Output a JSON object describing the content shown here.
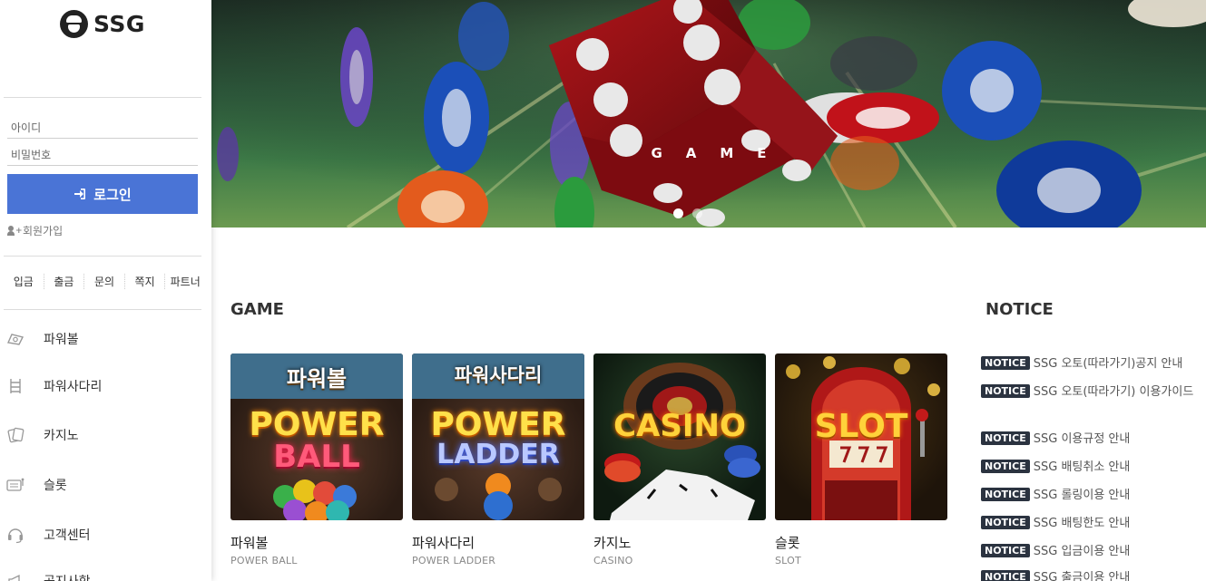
{
  "brand": {
    "name": "SSG"
  },
  "login": {
    "id_placeholder": "아이디",
    "password_placeholder": "비밀번호",
    "button_label": "로그인",
    "signup_label": "회원가입"
  },
  "quick_links": [
    "입금",
    "출금",
    "문의",
    "쪽지",
    "파트너"
  ],
  "menu": [
    {
      "label": "파워볼",
      "icon": "ball-icon"
    },
    {
      "label": "파워사다리",
      "icon": "ladder-icon"
    },
    {
      "label": "카지노",
      "icon": "cards-icon"
    },
    {
      "label": "슬롯",
      "icon": "slot-icon"
    },
    {
      "label": "고객센터",
      "icon": "headset-icon"
    },
    {
      "label": "공지사항",
      "icon": "megaphone-icon"
    }
  ],
  "banner": {
    "title": "GAME",
    "slide_count": 2,
    "active_slide": 1
  },
  "game_section": {
    "title": "GAME",
    "games": [
      {
        "name": "파워볼",
        "sub": "POWER BALL",
        "thumb_kr": "파워볼",
        "thumb_line1": "POWER",
        "thumb_line2": "BALL"
      },
      {
        "name": "파워사다리",
        "sub": "POWER LADDER",
        "thumb_kr": "파워사다리",
        "thumb_line1": "POWER",
        "thumb_line2": "LADDER"
      },
      {
        "name": "카지노",
        "sub": "CASINO",
        "thumb_line1": "CASINO"
      },
      {
        "name": "슬롯",
        "sub": "SLOT",
        "thumb_line1": "SLOT"
      }
    ]
  },
  "notice_section": {
    "title": "NOTICE",
    "badge": "NOTICE",
    "items": [
      "SSG 오토(따라가기)공지 안내",
      "SSG 오토(따라가기) 이용가이드",
      "SSG 이용규정 안내",
      "SSG 배팅취소 안내",
      "SSG 롤링이용 안내",
      "SSG 배팅한도 안내",
      "SSG 입금이용 안내",
      "SSG 출금이용 안내"
    ]
  },
  "colors": {
    "login_button": "#4a74d6",
    "badge_bg": "#2b3340"
  }
}
